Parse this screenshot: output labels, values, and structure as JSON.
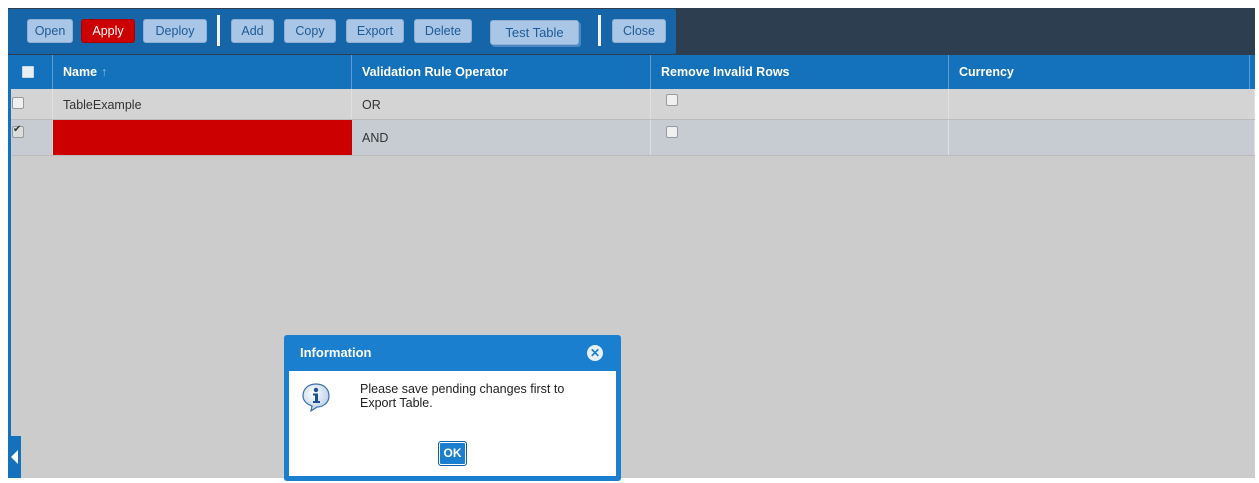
{
  "toolbar": {
    "open": "Open",
    "apply": "Apply",
    "deploy": "Deploy",
    "add": "Add",
    "copy": "Copy",
    "export": "Export",
    "delete": "Delete",
    "test_table": "Test Table",
    "close": "Close"
  },
  "grid": {
    "columns": [
      {
        "label": "Name",
        "sort_icon": "↑"
      },
      {
        "label": "Validation Rule Operator"
      },
      {
        "label": "Remove Invalid Rows"
      },
      {
        "label": "Currency"
      }
    ],
    "rows": [
      {
        "selected": false,
        "name": "TableExample",
        "operator": "OR",
        "remove_invalid_rows": false,
        "currency": "",
        "name_invalid": false
      },
      {
        "selected": true,
        "name": "",
        "operator": "AND",
        "remove_invalid_rows": false,
        "currency": "",
        "name_invalid": true
      }
    ]
  },
  "dialog": {
    "title": "Information",
    "message": "Please save pending changes first to Export Table.",
    "ok_label": "OK",
    "icon": "info-icon"
  },
  "colors": {
    "toolbar_bg": "#2c3e50",
    "header_bg": "#1471bb",
    "apply_red": "#cc0000",
    "invalid_cell_red": "#cc0000",
    "dialog_blue": "#1a7fcf"
  }
}
